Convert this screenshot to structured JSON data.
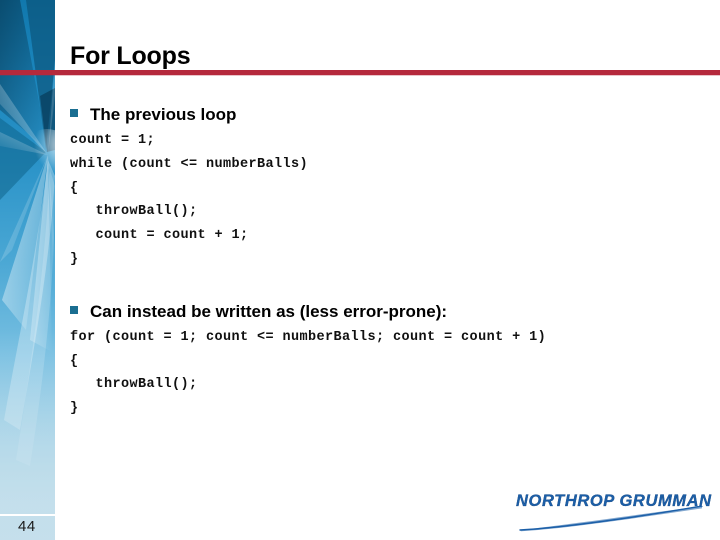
{
  "slide": {
    "title": "For Loops",
    "page_number": "44",
    "accent_rule_color": "#b5293c",
    "bullet_color": "#1a6e91",
    "sidebar_color": "#1178ad"
  },
  "sections": [
    {
      "bullet_glyph": "square-bullet",
      "heading": "The previous loop",
      "code": [
        "count = 1;",
        "while (count <= numberBalls)",
        "{",
        "   throwBall();",
        "   count = count + 1;",
        "}"
      ]
    },
    {
      "bullet_glyph": "square-bullet",
      "heading": "Can instead be written as (less error-prone):",
      "code": [
        "for (count = 1; count <= numberBalls; count = count + 1)",
        "{",
        "   throwBall();",
        "}"
      ]
    }
  ],
  "logo": {
    "name": "NORTHROP GRUMMAN",
    "color": "#1c5fa8"
  }
}
